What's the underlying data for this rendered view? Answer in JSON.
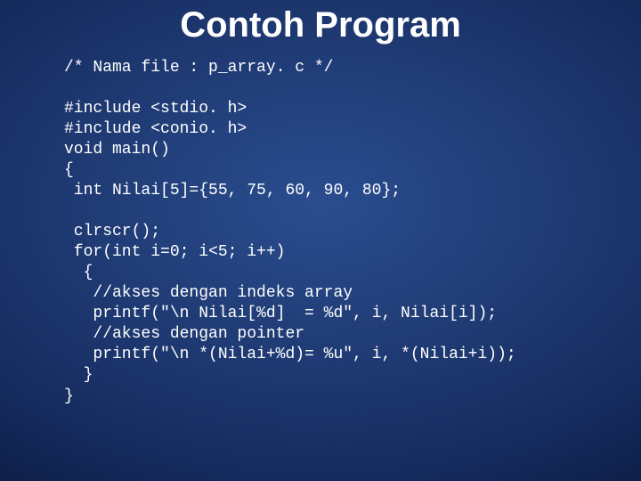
{
  "title": "Contoh Program",
  "code": {
    "l01": "/* Nama file : p_array. c */",
    "l02": "",
    "l03": "#include <stdio. h>",
    "l04": "#include <conio. h>",
    "l05": "void main()",
    "l06": "{",
    "l07": " int Nilai[5]={55, 75, 60, 90, 80};",
    "l08": "",
    "l09": " clrscr();",
    "l10": " for(int i=0; i<5; i++)",
    "l11": "  {",
    "l12": "   //akses dengan indeks array",
    "l13": "   printf(\"\\n Nilai[%d]  = %d\", i, Nilai[i]);",
    "l14": "   //akses dengan pointer",
    "l15": "   printf(\"\\n *(Nilai+%d)= %u\", i, *(Nilai+i));",
    "l16": "  }",
    "l17": "}"
  }
}
